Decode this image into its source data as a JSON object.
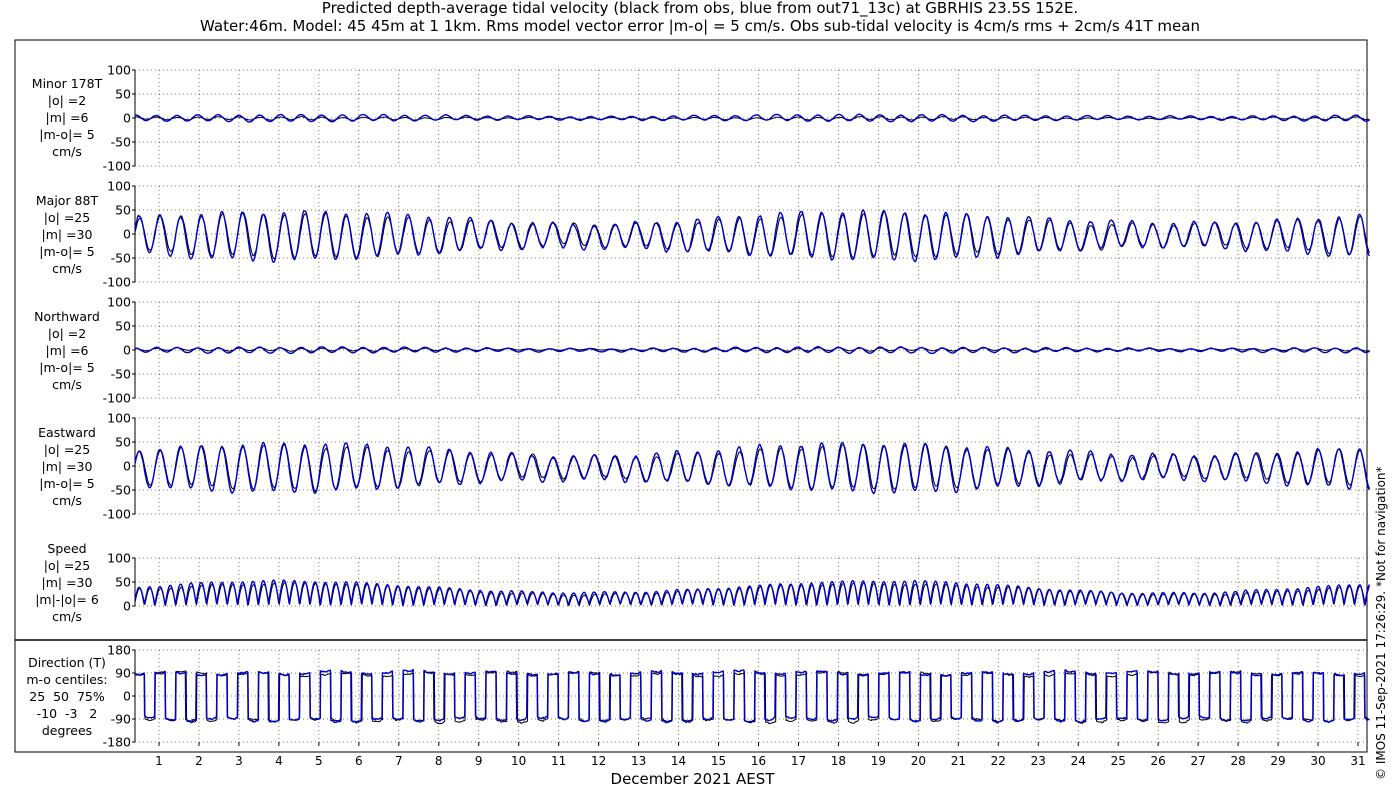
{
  "title": {
    "line1": "Predicted depth-average tidal velocity (black from obs, blue from out71_13c) at GBRHIS 23.5S 152E.",
    "line2": "Water:46m. Model: 45 45m at 1 1km. Rms model vector error |m-o| = 5 cm/s. Obs sub-tidal velocity is 4cm/s rms + 2cm/s 41T mean"
  },
  "copyright": "© IMOS 11-Sep-2021 17:26:29. *Not for navigation*",
  "colors": {
    "obs": "#000000",
    "model": "#0000cc",
    "axis": "#000000",
    "grid": "#555555"
  },
  "chart_data": [
    {
      "type": "line",
      "name": "minor",
      "label_lines": [
        "Minor 178T",
        "|o| =2",
        "|m| =6",
        "|m-o|= 5",
        "cm/s"
      ],
      "ylim": [
        -100,
        100
      ],
      "yticks": [
        -100,
        -50,
        0,
        50,
        100
      ],
      "yticklabels": [
        "-100",
        "-50",
        "0",
        "50",
        "100"
      ],
      "series": [
        {
          "role": "obs",
          "amp": 3,
          "offset": -1
        },
        {
          "role": "model",
          "amp": 7,
          "offset": 0
        }
      ]
    },
    {
      "type": "line",
      "name": "major",
      "label_lines": [
        "Major 88T",
        "|o| =25",
        "|m| =30",
        "|m-o|= 5",
        "cm/s"
      ],
      "ylim": [
        -100,
        100
      ],
      "yticks": [
        -100,
        -50,
        0,
        50,
        100
      ],
      "yticklabels": [
        "-100",
        "-50",
        "0",
        "50",
        "100"
      ],
      "series": [
        {
          "role": "obs",
          "amp": 45,
          "offset": -3
        },
        {
          "role": "model",
          "amp": 50,
          "offset": -3
        }
      ]
    },
    {
      "type": "line",
      "name": "northward",
      "label_lines": [
        "Northward",
        "|o| =2",
        "|m| =6",
        "|m-o|= 5",
        "cm/s"
      ],
      "ylim": [
        -100,
        100
      ],
      "yticks": [
        -100,
        -50,
        0,
        50,
        100
      ],
      "yticklabels": [
        "-100",
        "-50",
        "0",
        "50",
        "100"
      ],
      "series": [
        {
          "role": "obs",
          "amp": 3,
          "offset": 1
        },
        {
          "role": "model",
          "amp": 6,
          "offset": 0
        }
      ]
    },
    {
      "type": "line",
      "name": "eastward",
      "label_lines": [
        "Eastward",
        "|o| =25",
        "|m| =30",
        "|m-o|= 5",
        "cm/s"
      ],
      "ylim": [
        -100,
        100
      ],
      "yticks": [
        -100,
        -50,
        0,
        50,
        100
      ],
      "yticklabels": [
        "-100",
        "-50",
        "0",
        "50",
        "100"
      ],
      "series": [
        {
          "role": "obs",
          "amp": 45,
          "offset": -3
        },
        {
          "role": "model",
          "amp": 50,
          "offset": -3
        }
      ]
    },
    {
      "type": "line",
      "name": "speed",
      "label_lines": [
        "Speed",
        "|o| =25",
        "|m| =30",
        "|m|-|o|= 6",
        "cm/s"
      ],
      "ylim": [
        0,
        100
      ],
      "yticks": [
        0,
        50,
        100
      ],
      "yticklabels": [
        "0",
        "50",
        "100"
      ],
      "series": [
        {
          "role": "obs",
          "amp": 45,
          "offset": 0
        },
        {
          "role": "model",
          "amp": 50,
          "offset": 0
        }
      ]
    },
    {
      "type": "line",
      "name": "direction",
      "label_lines": [
        "Direction (T)",
        "m-o centiles:",
        "25  50  75%",
        "-10  -3   2",
        "degrees"
      ],
      "ylim": [
        -180,
        180
      ],
      "yticks": [
        -180,
        -90,
        0,
        90,
        180
      ],
      "yticklabels": [
        "-180",
        "-90",
        "0",
        "90",
        "180"
      ],
      "series": [
        {
          "role": "obs",
          "high": 88,
          "low": -92
        },
        {
          "role": "model",
          "high": 92,
          "low": -88
        }
      ]
    }
  ],
  "xaxis": {
    "label": "December 2021 AEST",
    "range_days": [
      0.4,
      31.3
    ],
    "ticks": [
      1,
      2,
      3,
      4,
      5,
      6,
      7,
      8,
      9,
      10,
      11,
      12,
      13,
      14,
      15,
      16,
      17,
      18,
      19,
      20,
      21,
      22,
      23,
      24,
      25,
      26,
      27,
      28,
      29,
      30,
      31
    ],
    "ticklabels": [
      "1",
      "2",
      "3",
      "4",
      "5",
      "6",
      "7",
      "8",
      "9",
      "10",
      "11",
      "12",
      "13",
      "14",
      "15",
      "16",
      "17",
      "18",
      "19",
      "20",
      "21",
      "22",
      "23",
      "24",
      "25",
      "26",
      "27",
      "28",
      "29",
      "30",
      "31"
    ],
    "tide_period_hours": 12.42,
    "spring_neap_period_days": 14.77,
    "grid": true
  }
}
